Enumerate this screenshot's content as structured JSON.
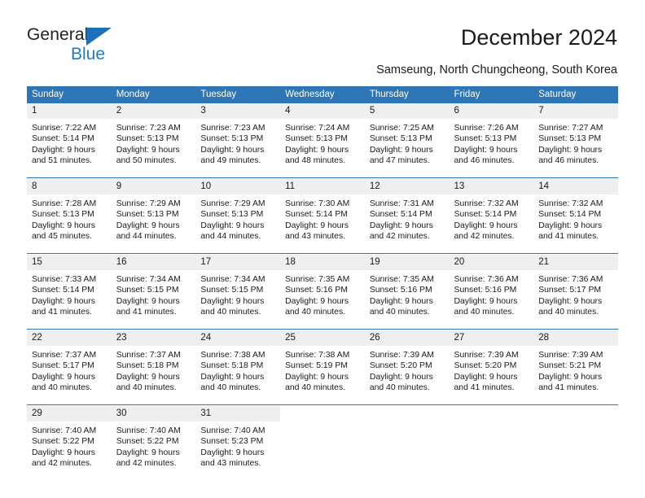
{
  "brand": {
    "name_top": "General",
    "name_bottom": "Blue",
    "triangle_icon": "triangle-right-icon",
    "accent_color": "#1f7bc1"
  },
  "header": {
    "title": "December 2024",
    "subtitle": "Samseung, North Chungcheong, South Korea"
  },
  "colors": {
    "header_row_bg": "#2e75b6",
    "daynum_bg": "#efefef",
    "rule": "#2e75b6",
    "text": "#1a1a1a"
  },
  "calendar": {
    "weekday_headers": [
      "Sunday",
      "Monday",
      "Tuesday",
      "Wednesday",
      "Thursday",
      "Friday",
      "Saturday"
    ],
    "weeks": [
      [
        {
          "day": "1",
          "sunrise": "Sunrise: 7:22 AM",
          "sunset": "Sunset: 5:14 PM",
          "daylight_1": "Daylight: 9 hours",
          "daylight_2": "and 51 minutes."
        },
        {
          "day": "2",
          "sunrise": "Sunrise: 7:23 AM",
          "sunset": "Sunset: 5:13 PM",
          "daylight_1": "Daylight: 9 hours",
          "daylight_2": "and 50 minutes."
        },
        {
          "day": "3",
          "sunrise": "Sunrise: 7:23 AM",
          "sunset": "Sunset: 5:13 PM",
          "daylight_1": "Daylight: 9 hours",
          "daylight_2": "and 49 minutes."
        },
        {
          "day": "4",
          "sunrise": "Sunrise: 7:24 AM",
          "sunset": "Sunset: 5:13 PM",
          "daylight_1": "Daylight: 9 hours",
          "daylight_2": "and 48 minutes."
        },
        {
          "day": "5",
          "sunrise": "Sunrise: 7:25 AM",
          "sunset": "Sunset: 5:13 PM",
          "daylight_1": "Daylight: 9 hours",
          "daylight_2": "and 47 minutes."
        },
        {
          "day": "6",
          "sunrise": "Sunrise: 7:26 AM",
          "sunset": "Sunset: 5:13 PM",
          "daylight_1": "Daylight: 9 hours",
          "daylight_2": "and 46 minutes."
        },
        {
          "day": "7",
          "sunrise": "Sunrise: 7:27 AM",
          "sunset": "Sunset: 5:13 PM",
          "daylight_1": "Daylight: 9 hours",
          "daylight_2": "and 46 minutes."
        }
      ],
      [
        {
          "day": "8",
          "sunrise": "Sunrise: 7:28 AM",
          "sunset": "Sunset: 5:13 PM",
          "daylight_1": "Daylight: 9 hours",
          "daylight_2": "and 45 minutes."
        },
        {
          "day": "9",
          "sunrise": "Sunrise: 7:29 AM",
          "sunset": "Sunset: 5:13 PM",
          "daylight_1": "Daylight: 9 hours",
          "daylight_2": "and 44 minutes."
        },
        {
          "day": "10",
          "sunrise": "Sunrise: 7:29 AM",
          "sunset": "Sunset: 5:13 PM",
          "daylight_1": "Daylight: 9 hours",
          "daylight_2": "and 44 minutes."
        },
        {
          "day": "11",
          "sunrise": "Sunrise: 7:30 AM",
          "sunset": "Sunset: 5:14 PM",
          "daylight_1": "Daylight: 9 hours",
          "daylight_2": "and 43 minutes."
        },
        {
          "day": "12",
          "sunrise": "Sunrise: 7:31 AM",
          "sunset": "Sunset: 5:14 PM",
          "daylight_1": "Daylight: 9 hours",
          "daylight_2": "and 42 minutes."
        },
        {
          "day": "13",
          "sunrise": "Sunrise: 7:32 AM",
          "sunset": "Sunset: 5:14 PM",
          "daylight_1": "Daylight: 9 hours",
          "daylight_2": "and 42 minutes."
        },
        {
          "day": "14",
          "sunrise": "Sunrise: 7:32 AM",
          "sunset": "Sunset: 5:14 PM",
          "daylight_1": "Daylight: 9 hours",
          "daylight_2": "and 41 minutes."
        }
      ],
      [
        {
          "day": "15",
          "sunrise": "Sunrise: 7:33 AM",
          "sunset": "Sunset: 5:14 PM",
          "daylight_1": "Daylight: 9 hours",
          "daylight_2": "and 41 minutes."
        },
        {
          "day": "16",
          "sunrise": "Sunrise: 7:34 AM",
          "sunset": "Sunset: 5:15 PM",
          "daylight_1": "Daylight: 9 hours",
          "daylight_2": "and 41 minutes."
        },
        {
          "day": "17",
          "sunrise": "Sunrise: 7:34 AM",
          "sunset": "Sunset: 5:15 PM",
          "daylight_1": "Daylight: 9 hours",
          "daylight_2": "and 40 minutes."
        },
        {
          "day": "18",
          "sunrise": "Sunrise: 7:35 AM",
          "sunset": "Sunset: 5:16 PM",
          "daylight_1": "Daylight: 9 hours",
          "daylight_2": "and 40 minutes."
        },
        {
          "day": "19",
          "sunrise": "Sunrise: 7:35 AM",
          "sunset": "Sunset: 5:16 PM",
          "daylight_1": "Daylight: 9 hours",
          "daylight_2": "and 40 minutes."
        },
        {
          "day": "20",
          "sunrise": "Sunrise: 7:36 AM",
          "sunset": "Sunset: 5:16 PM",
          "daylight_1": "Daylight: 9 hours",
          "daylight_2": "and 40 minutes."
        },
        {
          "day": "21",
          "sunrise": "Sunrise: 7:36 AM",
          "sunset": "Sunset: 5:17 PM",
          "daylight_1": "Daylight: 9 hours",
          "daylight_2": "and 40 minutes."
        }
      ],
      [
        {
          "day": "22",
          "sunrise": "Sunrise: 7:37 AM",
          "sunset": "Sunset: 5:17 PM",
          "daylight_1": "Daylight: 9 hours",
          "daylight_2": "and 40 minutes."
        },
        {
          "day": "23",
          "sunrise": "Sunrise: 7:37 AM",
          "sunset": "Sunset: 5:18 PM",
          "daylight_1": "Daylight: 9 hours",
          "daylight_2": "and 40 minutes."
        },
        {
          "day": "24",
          "sunrise": "Sunrise: 7:38 AM",
          "sunset": "Sunset: 5:18 PM",
          "daylight_1": "Daylight: 9 hours",
          "daylight_2": "and 40 minutes."
        },
        {
          "day": "25",
          "sunrise": "Sunrise: 7:38 AM",
          "sunset": "Sunset: 5:19 PM",
          "daylight_1": "Daylight: 9 hours",
          "daylight_2": "and 40 minutes."
        },
        {
          "day": "26",
          "sunrise": "Sunrise: 7:39 AM",
          "sunset": "Sunset: 5:20 PM",
          "daylight_1": "Daylight: 9 hours",
          "daylight_2": "and 40 minutes."
        },
        {
          "day": "27",
          "sunrise": "Sunrise: 7:39 AM",
          "sunset": "Sunset: 5:20 PM",
          "daylight_1": "Daylight: 9 hours",
          "daylight_2": "and 41 minutes."
        },
        {
          "day": "28",
          "sunrise": "Sunrise: 7:39 AM",
          "sunset": "Sunset: 5:21 PM",
          "daylight_1": "Daylight: 9 hours",
          "daylight_2": "and 41 minutes."
        }
      ],
      [
        {
          "day": "29",
          "sunrise": "Sunrise: 7:40 AM",
          "sunset": "Sunset: 5:22 PM",
          "daylight_1": "Daylight: 9 hours",
          "daylight_2": "and 42 minutes."
        },
        {
          "day": "30",
          "sunrise": "Sunrise: 7:40 AM",
          "sunset": "Sunset: 5:22 PM",
          "daylight_1": "Daylight: 9 hours",
          "daylight_2": "and 42 minutes."
        },
        {
          "day": "31",
          "sunrise": "Sunrise: 7:40 AM",
          "sunset": "Sunset: 5:23 PM",
          "daylight_1": "Daylight: 9 hours",
          "daylight_2": "and 43 minutes."
        },
        {
          "day": "",
          "sunrise": "",
          "sunset": "",
          "daylight_1": "",
          "daylight_2": ""
        },
        {
          "day": "",
          "sunrise": "",
          "sunset": "",
          "daylight_1": "",
          "daylight_2": ""
        },
        {
          "day": "",
          "sunrise": "",
          "sunset": "",
          "daylight_1": "",
          "daylight_2": ""
        },
        {
          "day": "",
          "sunrise": "",
          "sunset": "",
          "daylight_1": "",
          "daylight_2": ""
        }
      ]
    ]
  }
}
